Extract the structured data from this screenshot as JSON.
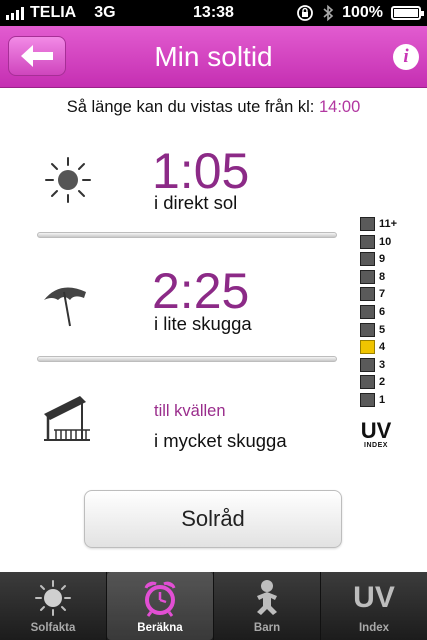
{
  "status_bar": {
    "carrier": "TELIA",
    "network": "3G",
    "time": "13:38",
    "battery": "100%",
    "signal_bars": 4
  },
  "nav": {
    "title": "Min soltid",
    "back_icon": "back-arrow-icon",
    "info_label": "i"
  },
  "intro": {
    "text": "Så länge kan du vistas ute från kl:",
    "time": "14:00"
  },
  "rows": [
    {
      "icon": "sun-icon",
      "value": "1:05",
      "label": "i direkt sol"
    },
    {
      "icon": "umbrella-icon",
      "value": "2:25",
      "label": "i lite skugga"
    },
    {
      "icon": "shelter-icon",
      "value": "till kvällen",
      "label": "i mycket skugga"
    }
  ],
  "uv_scale": {
    "levels": [
      "11+",
      "10",
      "9",
      "8",
      "7",
      "6",
      "5",
      "4",
      "3",
      "2",
      "1"
    ],
    "current": "4",
    "logo": "UV",
    "logo_sub": "INDEX",
    "active_color": "#f0c400"
  },
  "button": {
    "label": "Solråd"
  },
  "tabs": [
    {
      "label": "Solfakta",
      "icon": "sun-tab-icon",
      "active": false
    },
    {
      "label": "Beräkna",
      "icon": "alarm-clock-icon",
      "active": true
    },
    {
      "label": "Barn",
      "icon": "baby-icon",
      "active": false
    },
    {
      "label": "Index",
      "icon": "uv-index-icon",
      "icon_text": "UV",
      "active": false
    }
  ],
  "colors": {
    "accent": "#c735b5",
    "time_text": "#8c2a87"
  }
}
